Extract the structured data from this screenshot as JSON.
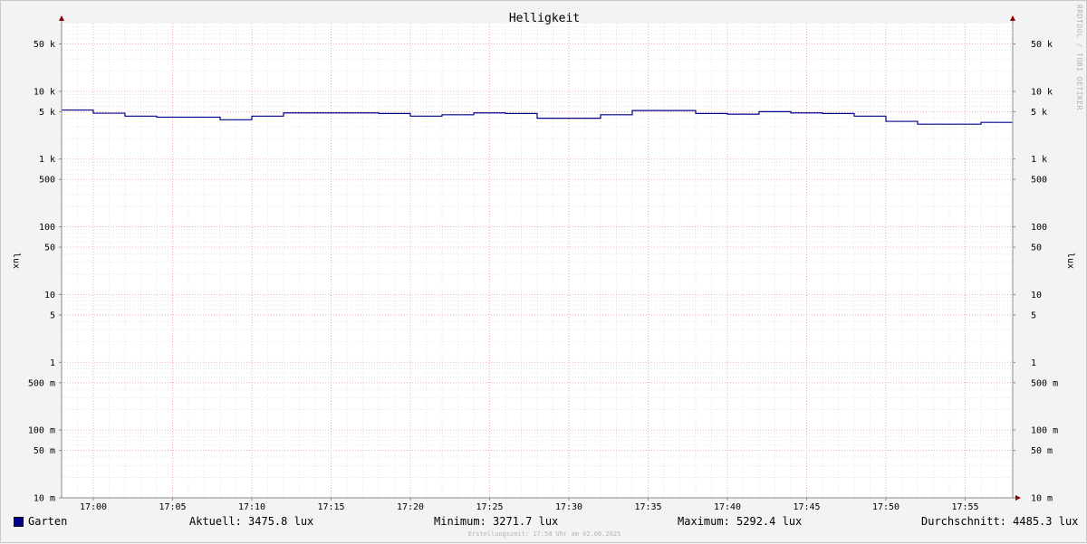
{
  "chart_data": {
    "type": "line",
    "title": "Helligkeit",
    "ylabel_left": "lux",
    "ylabel_right": "lux",
    "yscale": "log",
    "ylim": [
      0.01,
      100000
    ],
    "xlim": [
      "16:58",
      "17:58"
    ],
    "grid": true,
    "x_ticks": [
      "17:00",
      "17:05",
      "17:10",
      "17:15",
      "17:20",
      "17:25",
      "17:30",
      "17:35",
      "17:40",
      "17:45",
      "17:50",
      "17:55"
    ],
    "y_ticks": [
      {
        "value": 50000,
        "label": "50 k"
      },
      {
        "value": 10000,
        "label": "10 k"
      },
      {
        "value": 5000,
        "label": "5 k"
      },
      {
        "value": 1000,
        "label": "1 k"
      },
      {
        "value": 500,
        "label": "500"
      },
      {
        "value": 100,
        "label": "100"
      },
      {
        "value": 50,
        "label": "50"
      },
      {
        "value": 10,
        "label": "10"
      },
      {
        "value": 5,
        "label": "5"
      },
      {
        "value": 1,
        "label": "1"
      },
      {
        "value": 0.5,
        "label": "500 m"
      },
      {
        "value": 0.1,
        "label": "100 m"
      },
      {
        "value": 0.05,
        "label": "50 m"
      },
      {
        "value": 0.01,
        "label": "10 m"
      }
    ],
    "series": [
      {
        "name": "Garten",
        "color": "#00008b",
        "x": [
          "16:58",
          "17:00",
          "17:02",
          "17:04",
          "17:06",
          "17:08",
          "17:10",
          "17:12",
          "17:14",
          "17:16",
          "17:18",
          "17:20",
          "17:22",
          "17:24",
          "17:26",
          "17:28",
          "17:30",
          "17:32",
          "17:34",
          "17:36",
          "17:38",
          "17:40",
          "17:42",
          "17:44",
          "17:46",
          "17:48",
          "17:50",
          "17:52",
          "17:54",
          "17:56"
        ],
        "values": [
          5292.4,
          4750,
          4300,
          4150,
          4150,
          3800,
          4300,
          4800,
          4800,
          4800,
          4700,
          4300,
          4500,
          4800,
          4700,
          4000,
          4000,
          4500,
          5200,
          5200,
          4700,
          4600,
          5000,
          4800,
          4700,
          4300,
          3600,
          3271.7,
          3271.7,
          3475.8
        ]
      }
    ]
  },
  "legend": {
    "series_name": "Garten",
    "current": "Aktuell: 3475.8 lux",
    "minimum": "Minimum: 3271.7 lux",
    "maximum": "Maximum: 5292.4 lux",
    "average": "Durchschnitt: 4485.3 lux"
  },
  "footer": "Erstellungszeit: 17:58 Uhr am 02.06.2025",
  "watermark": "RRDTOOL / TOBI OETIKER"
}
